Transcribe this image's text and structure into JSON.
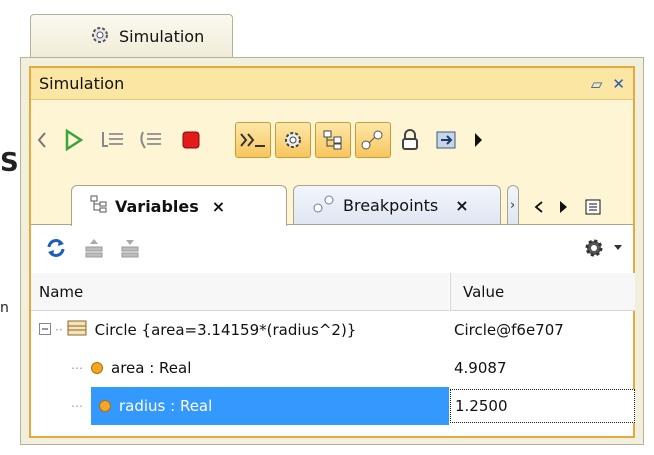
{
  "top_tab": {
    "label": "Simulation"
  },
  "panel": {
    "title": "Simulation"
  },
  "toolbar": {
    "buttons": [
      "back",
      "run",
      "step-into",
      "step-over",
      "terminate",
      "console",
      "animation",
      "pseudo-state",
      "auto-open-diagrams",
      "lock",
      "export-trace",
      "more"
    ]
  },
  "subtabs": [
    {
      "label": "Variables",
      "close": "×",
      "active": true
    },
    {
      "label": "Breakpoints",
      "close": "×",
      "active": false
    }
  ],
  "variables": {
    "columns": {
      "name": "Name",
      "value": "Value"
    },
    "rows": [
      {
        "name": "Circle {area=3.14159*(radius^2)}",
        "value": "Circle@f6e707",
        "level": 0,
        "expanded": true
      },
      {
        "name": "area : Real",
        "value": "4.9087",
        "level": 1
      },
      {
        "name": "radius : Real",
        "value": "1.2500",
        "level": 1,
        "selected": true
      }
    ]
  },
  "edge_fragments": [
    "S",
    "n"
  ],
  "colors": {
    "accent_orange": "#e5a93c",
    "selection": "#3399ff",
    "title_bar": "#fbe7a3"
  }
}
